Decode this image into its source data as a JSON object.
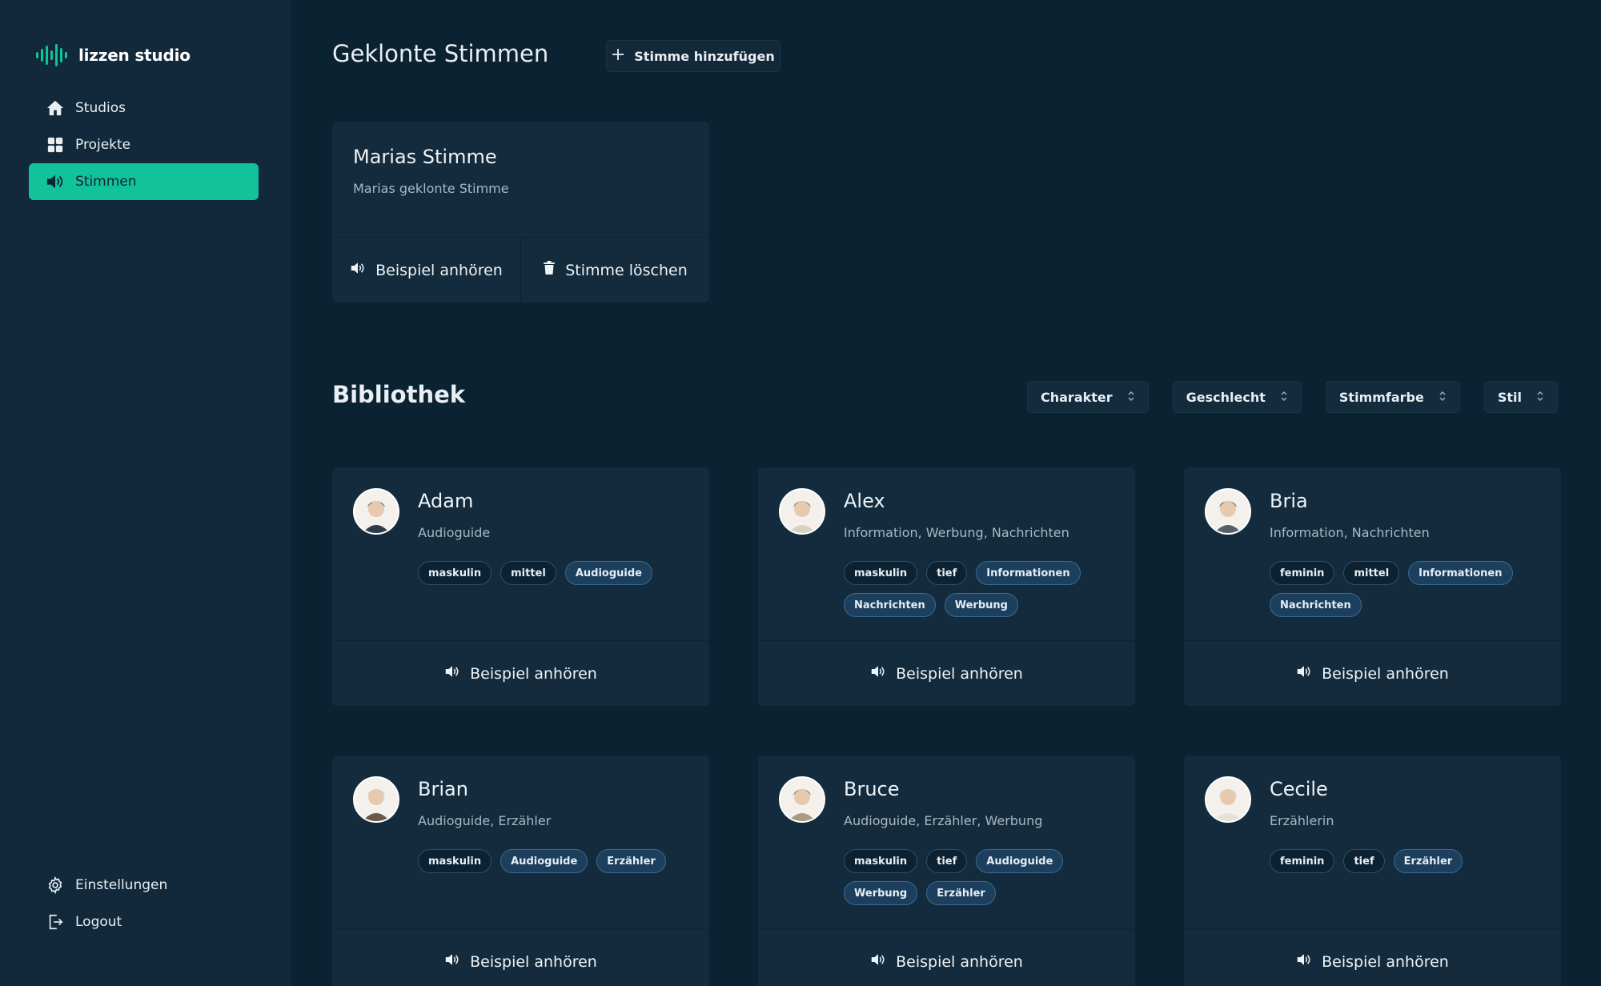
{
  "sidebar": {
    "logo": "lizzen studio",
    "items": [
      {
        "label": "Studios",
        "icon": "home-icon"
      },
      {
        "label": "Projekte",
        "icon": "grid-icon"
      },
      {
        "label": "Stimmen",
        "icon": "speaker-icon",
        "active": true
      }
    ],
    "bottom_items": [
      {
        "label": "Einstellungen",
        "icon": "gear-icon"
      },
      {
        "label": "Logout",
        "icon": "logout-icon"
      }
    ]
  },
  "cloned": {
    "title": "Geklonte Stimmen",
    "add_label": "Stimme hinzufügen",
    "card": {
      "name": "Marias Stimme",
      "description": "Marias geklonte Stimme",
      "play_label": "Beispiel anhören",
      "delete_label": "Stimme löschen"
    }
  },
  "library": {
    "title": "Bibliothek",
    "filters": [
      "Charakter",
      "Geschlecht",
      "Stimmfarbe",
      "Stil"
    ],
    "play_label": "Beispiel anhören",
    "voices": [
      {
        "name": "Adam",
        "desc": "Audioguide",
        "tags": [
          {
            "t": "maskulin"
          },
          {
            "t": "mittel"
          },
          {
            "t": "Audioguide",
            "accent": true
          }
        ]
      },
      {
        "name": "Alex",
        "desc": "Information, Werbung, Nachrichten",
        "tags": [
          {
            "t": "maskulin"
          },
          {
            "t": "tief"
          },
          {
            "t": "Informationen",
            "accent": true
          },
          {
            "t": "Nachrichten",
            "accent": true
          },
          {
            "t": "Werbung",
            "accent": true
          }
        ]
      },
      {
        "name": "Bria",
        "desc": "Information, Nachrichten",
        "tags": [
          {
            "t": "feminin"
          },
          {
            "t": "mittel"
          },
          {
            "t": "Informationen",
            "accent": true
          },
          {
            "t": "Nachrichten",
            "accent": true
          }
        ]
      },
      {
        "name": "Brian",
        "desc": "Audioguide, Erzähler",
        "tags": [
          {
            "t": "maskulin"
          },
          {
            "t": "Audioguide",
            "accent": true
          },
          {
            "t": "Erzähler",
            "accent": true
          }
        ]
      },
      {
        "name": "Bruce",
        "desc": "Audioguide, Erzähler, Werbung",
        "tags": [
          {
            "t": "maskulin"
          },
          {
            "t": "tief"
          },
          {
            "t": "Audioguide",
            "accent": true
          },
          {
            "t": "Werbung",
            "accent": true
          },
          {
            "t": "Erzähler",
            "accent": true
          }
        ]
      },
      {
        "name": "Cecile",
        "desc": "Erzählerin",
        "tags": [
          {
            "t": "feminin"
          },
          {
            "t": "tief"
          },
          {
            "t": "Erzähler",
            "accent": true
          }
        ]
      }
    ]
  },
  "colors": {
    "accent": "#12c29b",
    "background": "#0b2233",
    "sidebar": "#11293b",
    "card": "#132b3d"
  }
}
